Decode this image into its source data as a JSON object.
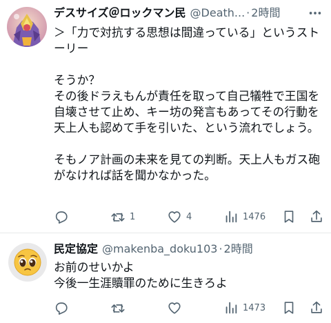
{
  "tweets": [
    {
      "display_name": "デスサイズ＠ロックマン民",
      "handle": "@Death...",
      "dot": "·",
      "time": "2時間",
      "body": [
        "＞「力で対抗する思想は間違っている」というストーリー",
        "そうか？\nその後ドラえもんが責任を取って自己犠牲で王国を自壊させて止め、キー坊の発言もあってその行動を天上人も認めて手を引いた、という流れでしょう。",
        "そもノア計画の未来を見ての判断。天上人もガス砲がなければ話を聞かなかった。"
      ],
      "replies": "",
      "retweets": "1",
      "likes": "4",
      "views": "1476",
      "avatar_icon": "anime-robot-avatar"
    },
    {
      "display_name": "民定協定",
      "handle": "@makenba_doku103",
      "dot": "·",
      "time": "2時間",
      "body": [
        "お前のせいかよ\n今後一生涯贖罪のために生きろよ"
      ],
      "replies": "",
      "retweets": "",
      "likes": "",
      "views": "1473",
      "avatar_icon": "pleading-face-emoji-avatar"
    }
  ],
  "colors": {
    "text": "#0f1419",
    "secondary": "#536471",
    "divider": "#e7e9ea",
    "background": "#ffffff"
  }
}
